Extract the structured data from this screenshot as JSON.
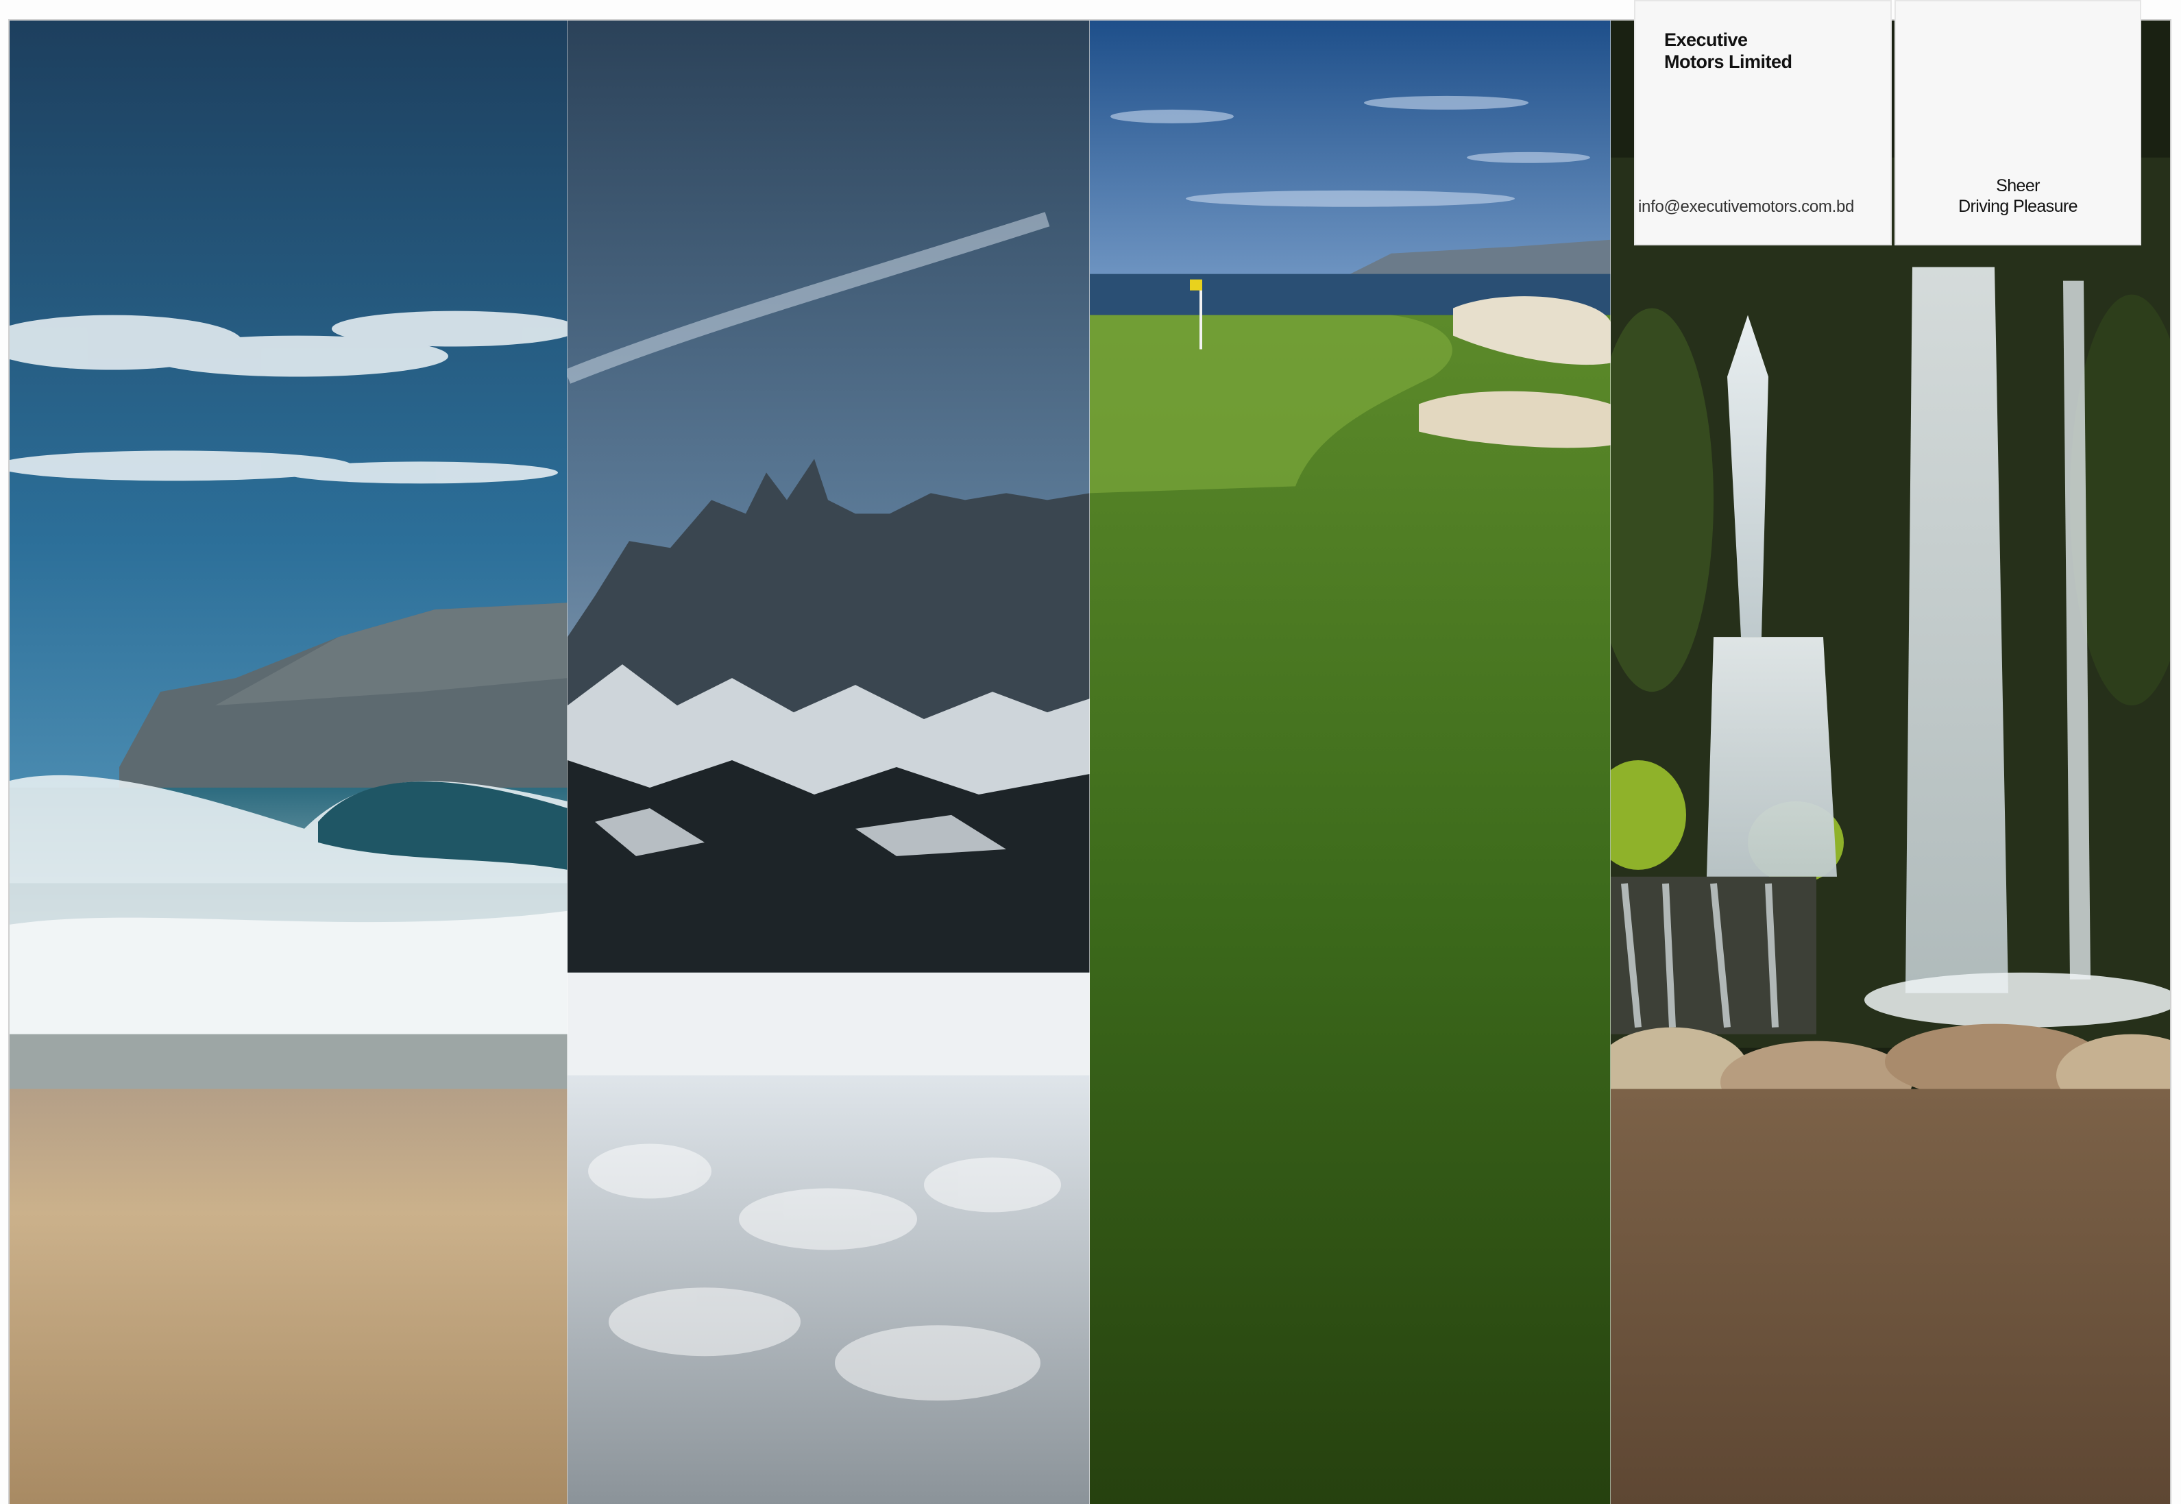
{
  "brand": {
    "company_name": "Executive\nMotors Limited",
    "email": "info@executivemotors.com.bd",
    "tagline": "Sheer\nDriving Pleasure"
  },
  "panels": [
    {
      "name": "beach-panel"
    },
    {
      "name": "snow-mountain-panel"
    },
    {
      "name": "golf-course-panel"
    },
    {
      "name": "waterfall-panel"
    }
  ],
  "colors": {
    "sky_dark": "#1f4e73",
    "sea": "#2f6f86",
    "sand": "#c9ad83",
    "snow": "#e6eaee",
    "grass": "#3f6a1f",
    "forest": "#1c2412",
    "card": "#f7f7f7"
  }
}
